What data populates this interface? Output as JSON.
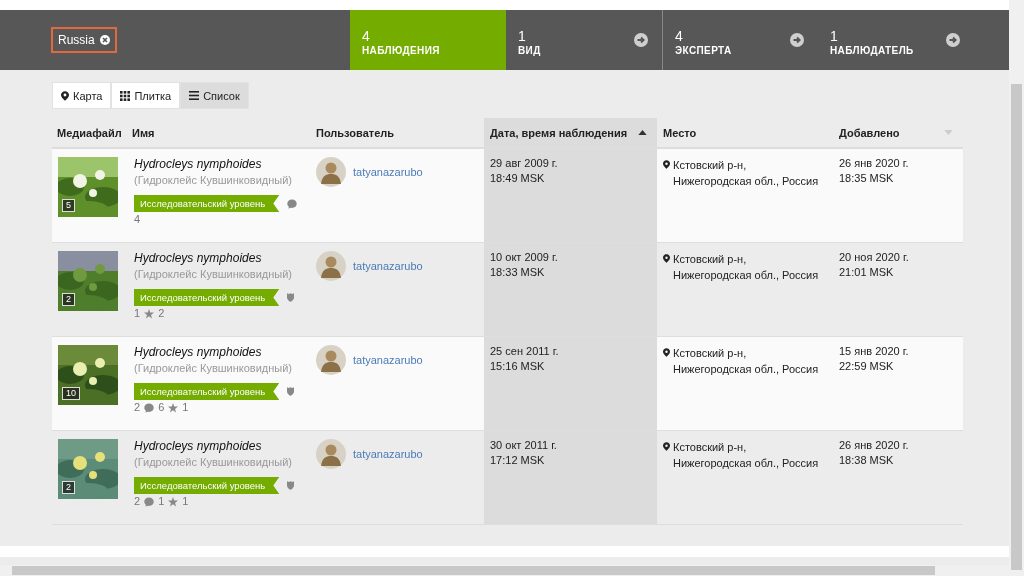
{
  "filter_chip": {
    "label": "Russia"
  },
  "stats_tabs": [
    {
      "count": "4",
      "label": "НАБЛЮДЕНИЯ",
      "selected": true
    },
    {
      "count": "1",
      "label": "ВИД",
      "selected": false
    },
    {
      "count": "4",
      "label": "ЭКСПЕРТА",
      "selected": false
    },
    {
      "count": "1",
      "label": "НАБЛЮДАТЕЛЬ",
      "selected": false
    }
  ],
  "view_tabs": [
    {
      "label": "Карта",
      "kind": "map",
      "selected": false
    },
    {
      "label": "Плитка",
      "kind": "grid",
      "selected": false
    },
    {
      "label": "Список",
      "kind": "list",
      "selected": true
    }
  ],
  "table": {
    "columns": [
      {
        "label": "Медиафайл"
      },
      {
        "label": "Имя"
      },
      {
        "label": "Пользователь"
      },
      {
        "label": "Дата, время наблюдения",
        "sortable": true,
        "ascending": true,
        "selected": true
      },
      {
        "label": "Место"
      },
      {
        "label": "Добавлено",
        "sortable": true,
        "ascending": false,
        "selected": false
      }
    ],
    "rows": [
      {
        "photo_count": "5",
        "name": "Hydrocleys nymphoides",
        "common_name": "(Гидроклейс Кувшинковидный)",
        "badge": "Исследовательский уровень",
        "stats": [
          {
            "kind": "comments",
            "count": "4"
          }
        ],
        "user": "tatyanazarubo",
        "date": "29 авг 2009 г.",
        "time": "18:49 MSK",
        "place": "Кстовский р-н, Нижегородская обл., Россия",
        "added_date": "26 янв 2020 г.",
        "added_time": "18:35 MSK"
      },
      {
        "photo_count": "2",
        "name": "Hydrocleys nymphoides",
        "common_name": "(Гидроклейс Кувшинковидный)",
        "badge": "Исследовательский уровень",
        "stats": [
          {
            "kind": "identifications",
            "count": "1"
          },
          {
            "kind": "faves",
            "count": "2"
          }
        ],
        "user": "tatyanazarubo",
        "date": "10 окт 2009 г.",
        "time": "18:33 MSK",
        "place": "Кстовский р-н, Нижегородская обл., Россия",
        "added_date": "20 ноя 2020 г.",
        "added_time": "21:01 MSK"
      },
      {
        "photo_count": "10",
        "name": "Hydrocleys nymphoides",
        "common_name": "(Гидроклейс Кувшинковидный)",
        "badge": "Исследовательский уровень",
        "stats": [
          {
            "kind": "identifications",
            "count": "2"
          },
          {
            "kind": "comments",
            "count": "6"
          },
          {
            "kind": "faves",
            "count": "1"
          }
        ],
        "user": "tatyanazarubo",
        "date": "25 сен 2011 г.",
        "time": "15:16 MSK",
        "place": "Кстовский р-н, Нижегородская обл., Россия",
        "added_date": "15 янв 2020 г.",
        "added_time": "22:59 MSK"
      },
      {
        "photo_count": "2",
        "name": "Hydrocleys nymphoides",
        "common_name": "(Гидроклейс Кувшинковидный)",
        "badge": "Исследовательский уровень",
        "stats": [
          {
            "kind": "identifications",
            "count": "2"
          },
          {
            "kind": "comments",
            "count": "1"
          },
          {
            "kind": "faves",
            "count": "1"
          }
        ],
        "user": "tatyanazarubo",
        "date": "30 окт 2011 г.",
        "time": "17:12 MSK",
        "place": "Кстовский р-н, Нижегородская обл., Россия",
        "added_date": "26 янв 2020 г.",
        "added_time": "18:38 MSK"
      }
    ]
  }
}
